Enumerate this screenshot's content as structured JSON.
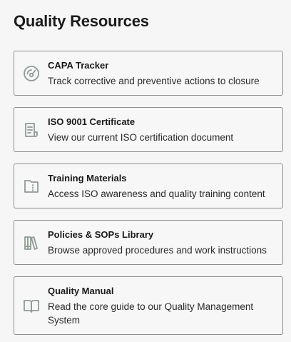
{
  "heading": "Quality Resources",
  "icon_color": "#8f9b93",
  "resources": [
    {
      "title": "CAPA Tracker",
      "description": "Track corrective and preventive actions to closure",
      "icon": "gauge-icon"
    },
    {
      "title": "ISO 9001 Certificate",
      "description": "View our current ISO certification document",
      "icon": "certificate-icon"
    },
    {
      "title": "Training Materials",
      "description": "Access ISO awareness and quality training content",
      "icon": "folder-icon"
    },
    {
      "title": "Policies & SOPs Library",
      "description": "Browse approved procedures and work instructions",
      "icon": "books-icon"
    },
    {
      "title": "Quality Manual",
      "description": "Read the core guide to our Quality Management System",
      "icon": "open-book-icon"
    }
  ]
}
